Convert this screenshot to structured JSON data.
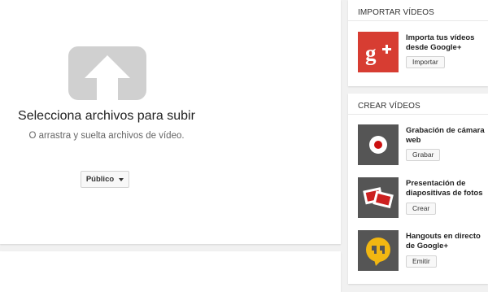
{
  "upload": {
    "title": "Selecciona archivos para subir",
    "subtitle": "O arrastra y suelta archivos de vídeo.",
    "privacy_label": "Público"
  },
  "import_section": {
    "title": "IMPORTAR VÍDEOS",
    "items": [
      {
        "title": "Importa tus vídeos desde Google+",
        "button": "Importar",
        "icon": "google-plus-icon"
      }
    ]
  },
  "create_section": {
    "title": "CREAR VÍDEOS",
    "items": [
      {
        "title": "Grabación de cámara web",
        "button": "Grabar",
        "icon": "webcam-record-icon"
      },
      {
        "title": "Presentación de diapositivas de fotos",
        "button": "Crear",
        "icon": "photo-slideshow-icon"
      },
      {
        "title": "Hangouts en directo de Google+",
        "button": "Emitir",
        "icon": "hangouts-icon"
      }
    ]
  },
  "colors": {
    "google_plus_red": "#d73d32",
    "thumb_dark": "#555555",
    "record_red": "#cc1010",
    "hangouts_yellow": "#f2b712"
  }
}
